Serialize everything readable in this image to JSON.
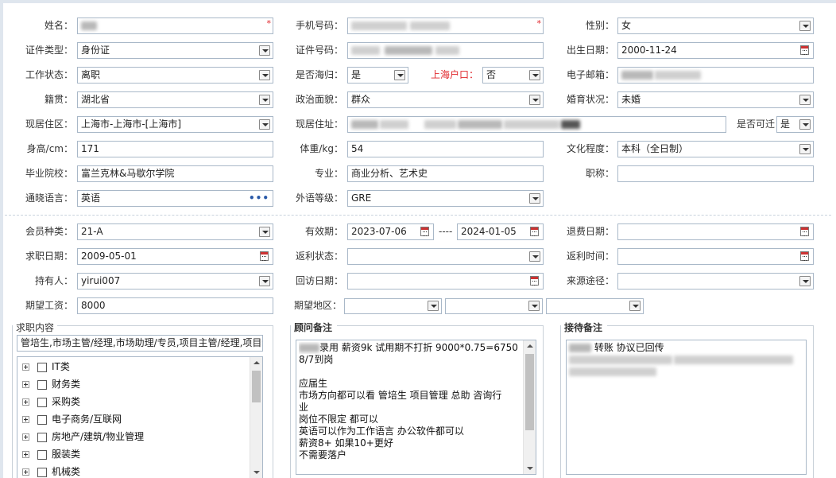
{
  "personal": {
    "name_label": "姓名：",
    "mobile_label": "手机号码：",
    "gender_label": "性别：",
    "gender_value": "女",
    "id_type_label": "证件类型：",
    "id_type_value": "身份证",
    "id_no_label": "证件号码：",
    "birth_label": "出生日期：",
    "birth_value": "2000-11-24",
    "work_status_label": "工作状态：",
    "work_status_value": "离职",
    "returnee_label": "是否海归：",
    "returnee_value": "是",
    "sh_hukou_label": "上海户口：",
    "sh_hukou_value": "否",
    "email_label": "电子邮箱：",
    "native_label": "籍贯：",
    "native_value": "湖北省",
    "political_label": "政治面貌：",
    "political_value": "群众",
    "marital_label": "婚育状况：",
    "marital_value": "未婚",
    "residence_label": "现居住区：",
    "residence_value": "上海市-上海市-[上海市]",
    "address_label": "现居住址：",
    "relocate_label": "是否可迁",
    "relocate_value": "是",
    "height_label": "身高/cm：",
    "height_value": "171",
    "weight_label": "体重/kg：",
    "weight_value": "54",
    "education_label": "文化程度：",
    "education_value": "本科（全日制）",
    "school_label": "毕业院校：",
    "school_value": "富兰克林&马歇尔学院",
    "major_label": "专业：",
    "major_value": "商业分析、艺术史",
    "title_label": "职称：",
    "language_label": "通晓语言：",
    "language_value": "英语",
    "foreign_level_label": "外语等级：",
    "foreign_level_value": "GRE"
  },
  "membership": {
    "member_type_label": "会员种类：",
    "member_type_value": "21-A",
    "validity_label": "有效期：",
    "validity_from": "2023-07-06",
    "validity_sep": "----",
    "validity_to": "2024-01-05",
    "refund_date_label": "退费日期：",
    "job_date_label": "求职日期：",
    "job_date_value": "2009-05-01",
    "rebate_status_label": "返利状态：",
    "rebate_time_label": "返利时间：",
    "holder_label": "持有人：",
    "holder_value": "yirui007",
    "visit_date_label": "回访日期：",
    "source_label": "来源途径：",
    "salary_label": "期望工资：",
    "salary_value": "8000",
    "area_label": "期望地区："
  },
  "job_content": {
    "title": "求职内容",
    "selected_text": "管培生,市场主管/经理,市场助理/专员,项目主管/经理,项目经",
    "categories": [
      "IT类",
      "财务类",
      "采购类",
      "电子商务/互联网",
      "房地产/建筑/物业管理",
      "服装类",
      "机械类"
    ]
  },
  "advisor_note": {
    "title": "顾问备注",
    "lines": [
      "录用  薪资9k 试用期不打折  9000*0.75=6750",
      "8/7到岗",
      "",
      "应届生",
      "市场方向都可以看   管培生   项目管理 总助 咨询行",
      "业",
      "岗位不限定 都可以",
      "英语可以作为工作语言     办公软件都可以",
      "薪资8+   如果10+更好",
      "不需要落户"
    ]
  },
  "reception_note": {
    "title": "接待备注",
    "line1": "转账   协议已回传"
  },
  "colors": {
    "required_mark": "#e0262b",
    "border": "#a9b8c8",
    "hukou_label": "#e0262b"
  },
  "icons": {
    "dropdown": "chevron-down-icon",
    "calendar": "calendar-icon",
    "more": "more-icon",
    "expand": "plus-icon"
  }
}
